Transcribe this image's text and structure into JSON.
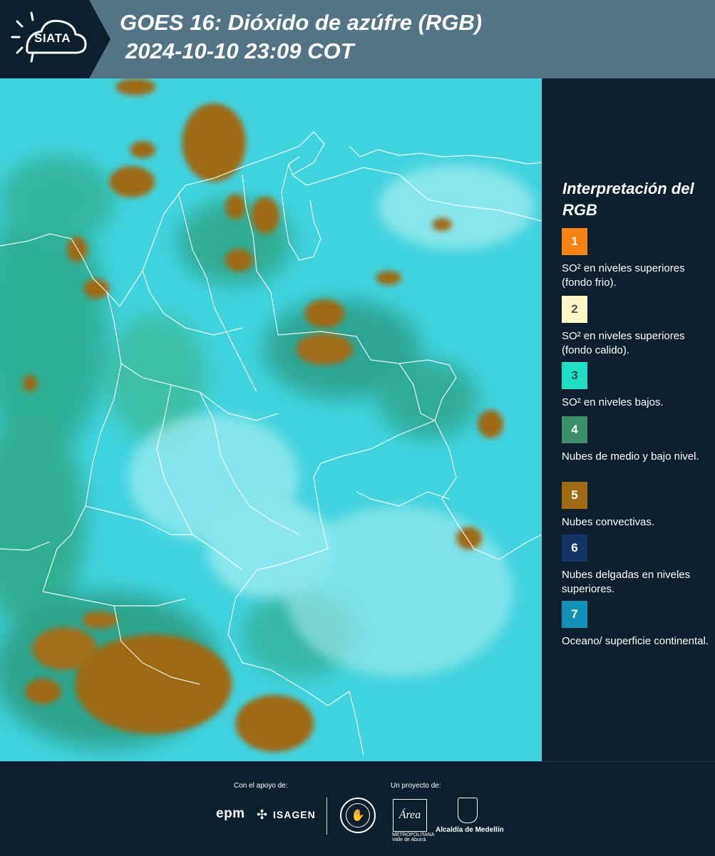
{
  "header": {
    "logo_text": "SIATA",
    "title_line1": "GOES 16: Dióxido de azúfre (RGB)",
    "title_line2": "2024-10-10 23:09 COT"
  },
  "legend": {
    "title": "Interpretación del RGB",
    "items": [
      {
        "number": "1",
        "color": "#f7820f",
        "text_color": "#ffffff",
        "label": "SO² en niveles superiores (fondo frio)."
      },
      {
        "number": "2",
        "color": "#fff6c6",
        "text_color": "#555555",
        "label": "SO² en niveles superiores (fondo calido)."
      },
      {
        "number": "3",
        "color": "#1de0c4",
        "text_color": "#1a4d4d",
        "label": "SO² en niveles bajos."
      },
      {
        "number": "4",
        "color": "#3a9068",
        "text_color": "#ffffff",
        "label": "Nubes de medio y bajo nivel."
      },
      {
        "number": "5",
        "color": "#9e6a14",
        "text_color": "#ffffff",
        "label": "Nubes convectivas."
      },
      {
        "number": "6",
        "color": "#123667",
        "text_color": "#ffffff",
        "label": "Nubes delgadas en niveles superiores."
      },
      {
        "number": "7",
        "color": "#1190b8",
        "text_color": "#ffffff",
        "label": "Oceano/ superficie continental."
      }
    ]
  },
  "footer": {
    "support_label": "Con el apoyo de:",
    "project_label": "Un proyecto de:",
    "epm": "epm",
    "isagen": "ISAGEN",
    "area_logo": "Área",
    "area_sub": "METROPOLITANA Valle de Aburrá",
    "alcaldia": "Alcaldía de Medellín"
  }
}
